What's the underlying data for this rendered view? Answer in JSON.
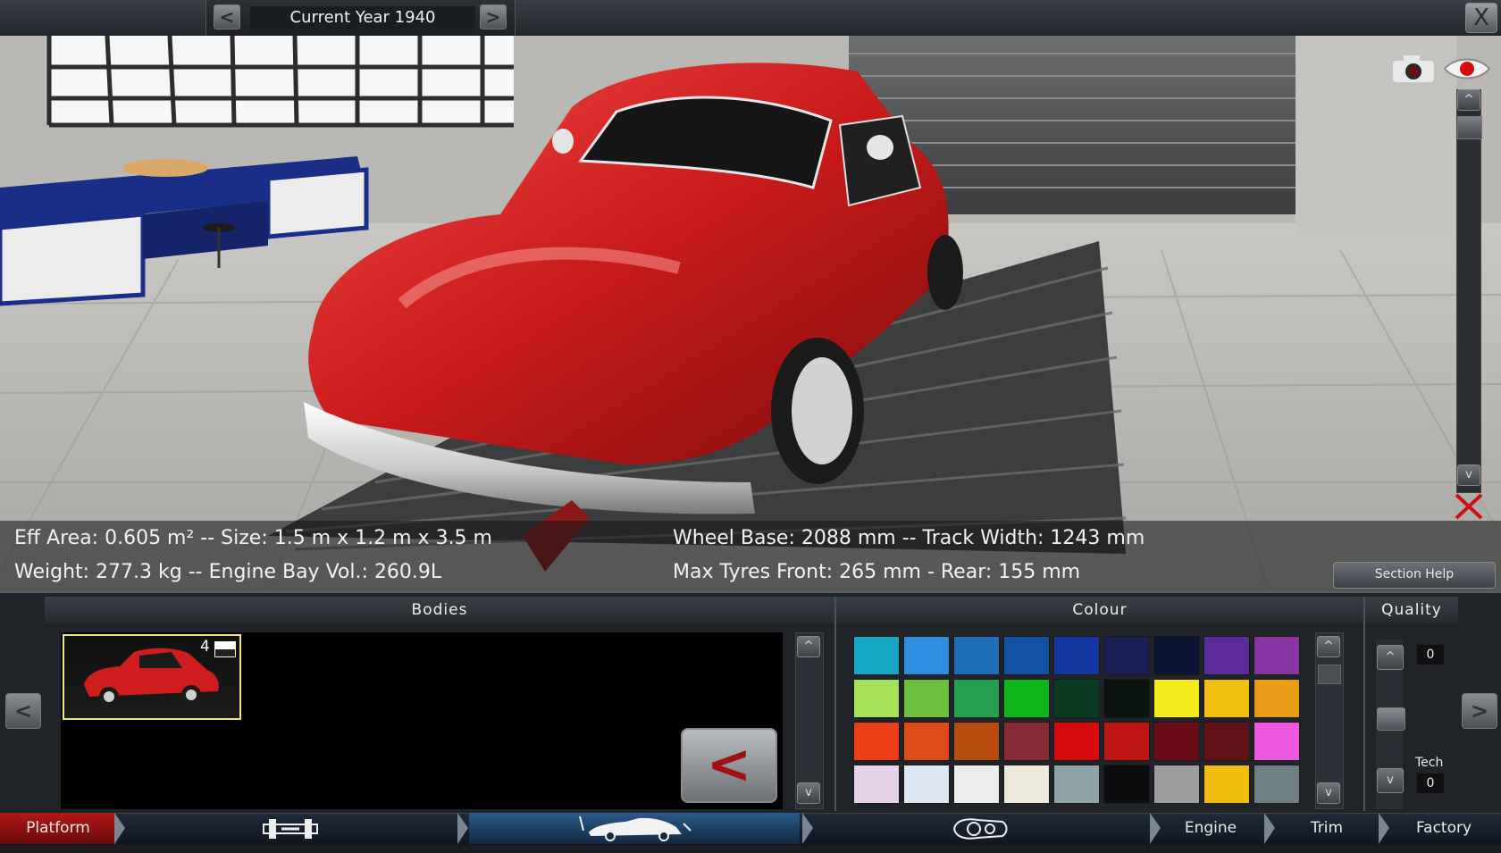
{
  "top": {
    "prev_label": "<",
    "next_label": ">",
    "year_label": "Current Year 1940",
    "close_label": "X"
  },
  "stats": {
    "line1": "Eff Area: 0.605 m² -- Size: 1.5 m x 1.2 m x 3.5 m",
    "line2": "Weight: 277.3 kg -- Engine Bay Vol.: 260.9L",
    "line3": "Wheel Base: 2088 mm -- Track Width: 1243 mm",
    "line4": "Max Tyres Front: 265 mm - Rear: 155 mm"
  },
  "section_help": "Section Help",
  "scroll": {
    "up": "^",
    "down": "v"
  },
  "bodies": {
    "header": "Bodies",
    "thumb_count": "4",
    "back_label": "<"
  },
  "colour": {
    "header": "Colour",
    "swatches": [
      "#17a7c6",
      "#2e8fe0",
      "#1e6fb8",
      "#1352a5",
      "#1436a0",
      "#191f55",
      "#0b1433",
      "#5b2a9b",
      "#8a33a3",
      "#a4e05a",
      "#6cc03d",
      "#25a050",
      "#0fb51b",
      "#0b3a22",
      "#0b1410",
      "#f5ea1b",
      "#f0c10e",
      "#e89b14",
      "#ee4018",
      "#de4a18",
      "#b94c0f",
      "#872b36",
      "#d7090a",
      "#be1614",
      "#6a0c15",
      "#601216",
      "#ec5ae0",
      "#e7d0ea",
      "#dde8f4",
      "#ececed",
      "#eeeadb",
      "#8da3a8",
      "#0b0d0e",
      "#9b9d9e",
      "#f1be10",
      "#6c8086"
    ]
  },
  "quality": {
    "header": "Quality",
    "value": "0",
    "tech_label": "Tech",
    "tech_value": "0"
  },
  "nav": {
    "platform": "Platform",
    "engine": "Engine",
    "trim": "Trim",
    "factory": "Factory"
  },
  "icons": [
    "camera-icon",
    "eye-icon",
    "close-icon",
    "chassis-icon",
    "car-body-icon",
    "headlight-icon",
    "reset-view-icon"
  ]
}
